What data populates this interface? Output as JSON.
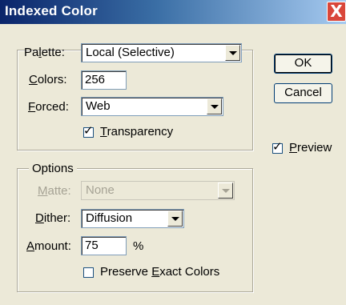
{
  "window": {
    "title": "Indexed Color",
    "close_glyph": "X"
  },
  "palette_group": {
    "palette": {
      "label_pre": "Pa",
      "label_ul": "l",
      "label_post": "ette:",
      "value": "Local (Selective)"
    },
    "colors": {
      "label_pre": "",
      "label_ul": "C",
      "label_post": "olors:",
      "value": "256"
    },
    "forced": {
      "label_pre": "",
      "label_ul": "F",
      "label_post": "orced:",
      "value": "Web"
    },
    "transparency": {
      "label_pre": "",
      "label_ul": "T",
      "label_post": "ransparency",
      "checked": true,
      "glyph": "✓"
    }
  },
  "options_group": {
    "legend": "Options",
    "matte": {
      "label_pre": "",
      "label_ul": "M",
      "label_post": "atte:",
      "value": "None",
      "disabled": true
    },
    "dither": {
      "label_pre": "",
      "label_ul": "D",
      "label_post": "ither:",
      "value": "Diffusion"
    },
    "amount": {
      "label_pre": "",
      "label_ul": "A",
      "label_post": "mount:",
      "value": "75",
      "unit": "%"
    },
    "preserve": {
      "label_pre": "Preserve ",
      "label_ul": "E",
      "label_post": "xact Colors",
      "checked": false
    }
  },
  "buttons": {
    "ok": "OK",
    "cancel": "Cancel"
  },
  "preview": {
    "label_pre": "",
    "label_ul": "P",
    "label_post": "review",
    "checked": true,
    "glyph": "✓"
  }
}
